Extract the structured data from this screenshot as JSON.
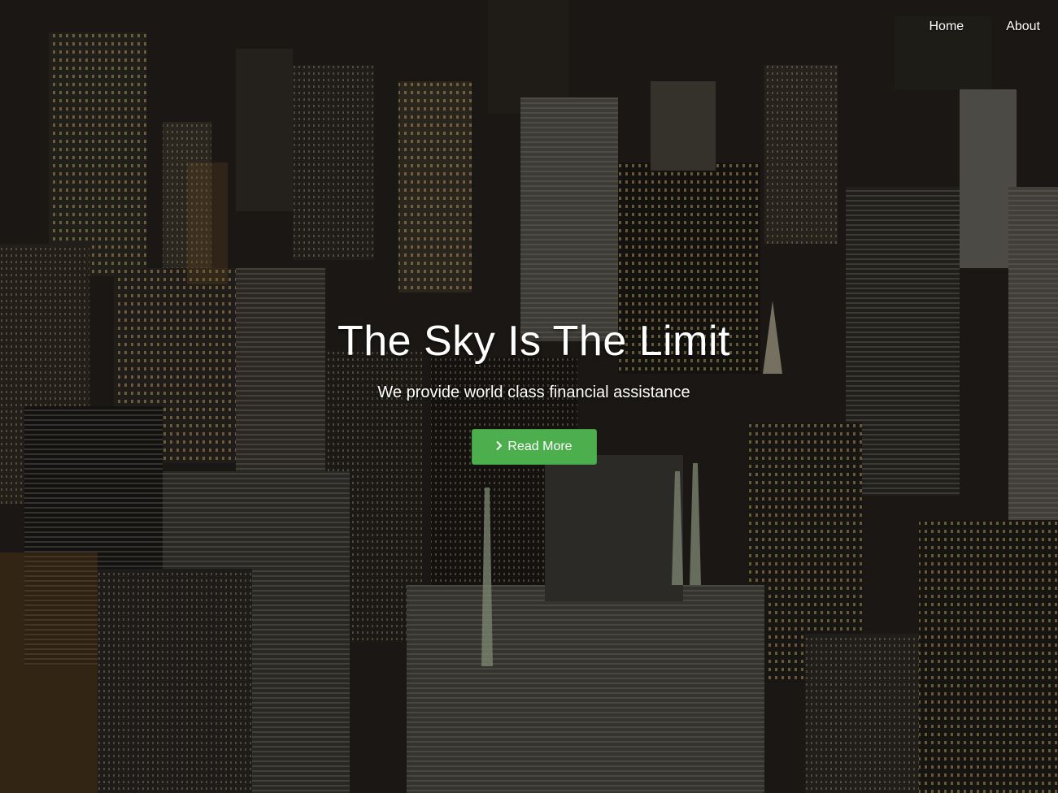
{
  "nav": {
    "items": [
      {
        "label": "Home"
      },
      {
        "label": "About"
      }
    ]
  },
  "hero": {
    "title": "The Sky Is The Limit",
    "subtitle": "We provide world class financial assistance",
    "button_label": "Read More",
    "button_icon": "chevron-right-icon"
  },
  "colors": {
    "button": "#4cae4c",
    "text": "#ffffff"
  }
}
